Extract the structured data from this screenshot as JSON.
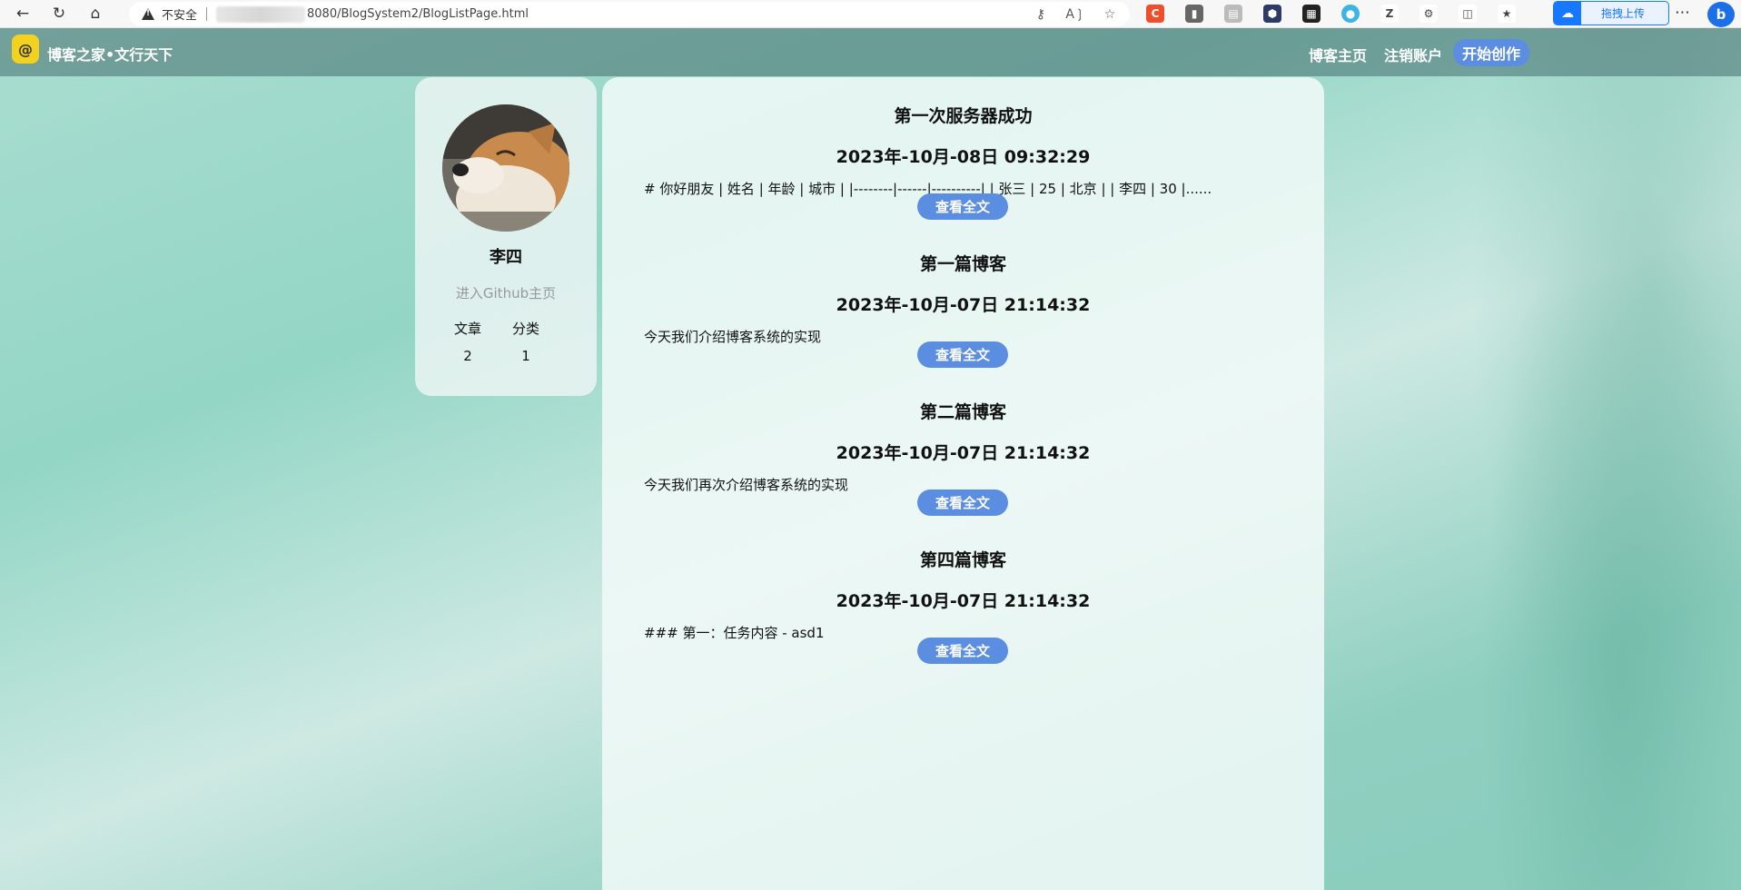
{
  "browser": {
    "insecure_label": "不安全",
    "url_path": "8080/BlogSystem2/BlogListPage.html",
    "upload_label": "拖拽上传"
  },
  "nav": {
    "site_title": "博客之家•文行天下",
    "home": "博客主页",
    "logout": "注销账户",
    "write": "开始创作"
  },
  "user": {
    "name": "李四",
    "github": "进入Github主页",
    "stats": [
      {
        "label": "文章",
        "value": "2"
      },
      {
        "label": "分类",
        "value": "1"
      }
    ]
  },
  "blogs": [
    {
      "title": "第一次服务器成功",
      "date": "2023年-10月-08日 09:32:29",
      "desc": "# 你好朋友 | 姓名 | 年龄 | 城市 | |--------|------|----------| | 张三 | 25 | 北京 | | 李四 | 30 |......",
      "button": "查看全文"
    },
    {
      "title": "第一篇博客",
      "date": "2023年-10月-07日 21:14:32",
      "desc": "今天我们介绍博客系统的实现",
      "button": "查看全文"
    },
    {
      "title": "第二篇博客",
      "date": "2023年-10月-07日 21:14:32",
      "desc": "今天我们再次介绍博客系统的实现",
      "button": "查看全文"
    },
    {
      "title": "第四篇博客",
      "date": "2023年-10月-07日 21:14:32",
      "desc": "### 第一：任务内容 - asd1",
      "button": "查看全文"
    }
  ]
}
